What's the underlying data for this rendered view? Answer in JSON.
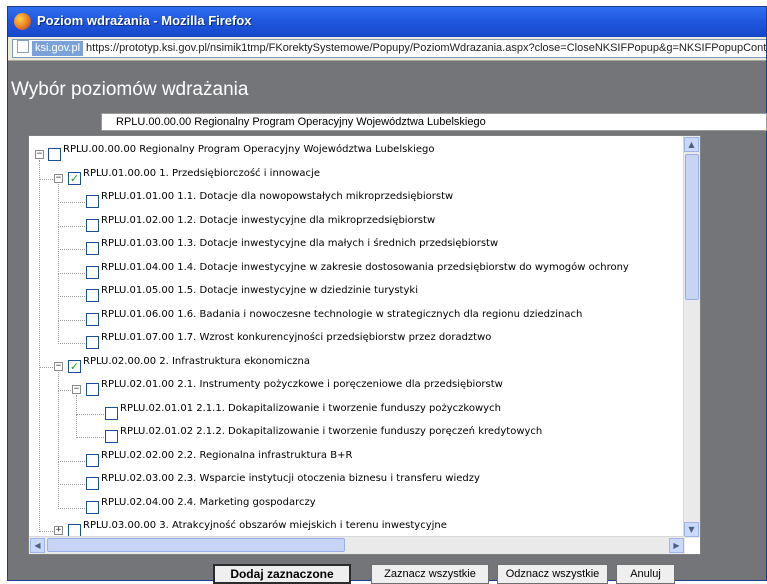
{
  "window": {
    "title": "Poziom wdrażania - Mozilla Firefox"
  },
  "addressbar": {
    "site_label": "ksi.gov.pl",
    "url": "https://prototyp.ksi.gov.pl/nsimik1tmp/FKorektySystemowe/Popupy/PoziomWdrazania.aspx?close=CloseNKSIFPopup&g=NKSIFPopupContentPlaceholder"
  },
  "dialog": {
    "heading": "Wybór poziomów wdrażania",
    "selected_value": "RPLU.00.00.00 Regionalny Program Operacyjny Województwa Lubelskiego"
  },
  "tree": {
    "nodes": [
      {
        "label": "RPLU.00.00.00 Regionalny Program Operacyjny Województwa Lubelskiego",
        "depth": 0,
        "toggle": "minus",
        "checked": false
      },
      {
        "label": "RPLU.01.00.00 1. Przedsiębiorczość i innowacje",
        "depth": 1,
        "toggle": "minus",
        "checked": true
      },
      {
        "label": "RPLU.01.01.00 1.1. Dotacje dla nowopowstałych mikroprzedsiębiorstw",
        "depth": 2,
        "toggle": "none",
        "checked": false
      },
      {
        "label": "RPLU.01.02.00 1.2. Dotacje inwestycyjne dla mikroprzedsiębiorstw",
        "depth": 2,
        "toggle": "none",
        "checked": false
      },
      {
        "label": "RPLU.01.03.00 1.3. Dotacje inwestycyjne dla małych i średnich przedsiębiorstw",
        "depth": 2,
        "toggle": "none",
        "checked": false
      },
      {
        "label": "RPLU.01.04.00 1.4. Dotacje inwestycyjne w zakresie dostosowania przedsiębiorstw do wymogów ochrony",
        "depth": 2,
        "toggle": "none",
        "checked": false
      },
      {
        "label": "RPLU.01.05.00 1.5. Dotacje inwestycyjne w dziedzinie turystyki",
        "depth": 2,
        "toggle": "none",
        "checked": false
      },
      {
        "label": "RPLU.01.06.00 1.6. Badania i nowoczesne technologie w strategicznych dla regionu dziedzinach",
        "depth": 2,
        "toggle": "none",
        "checked": false
      },
      {
        "label": "RPLU.01.07.00 1.7. Wzrost konkurencyjności przedsiębiorstw przez doradztwo",
        "depth": 2,
        "toggle": "none",
        "checked": false
      },
      {
        "label": "RPLU.02.00.00 2. Infrastruktura ekonomiczna",
        "depth": 1,
        "toggle": "minus",
        "checked": true
      },
      {
        "label": "RPLU.02.01.00 2.1. Instrumenty pożyczkowe i poręczeniowe dla przedsiębiorstw",
        "depth": 2,
        "toggle": "minus",
        "checked": false
      },
      {
        "label": "RPLU.02.01.01 2.1.1. Dokapitalizowanie i tworzenie funduszy pożyczkowych",
        "depth": 3,
        "toggle": "none",
        "checked": false
      },
      {
        "label": "RPLU.02.01.02 2.1.2. Dokapitalizowanie i tworzenie funduszy poręczeń kredytowych",
        "depth": 3,
        "toggle": "none",
        "checked": false
      },
      {
        "label": "RPLU.02.02.00 2.2. Regionalna infrastruktura B+R",
        "depth": 2,
        "toggle": "none",
        "checked": false
      },
      {
        "label": "RPLU.02.03.00 2.3. Wsparcie instytucji otoczenia biznesu i transferu wiedzy",
        "depth": 2,
        "toggle": "none",
        "checked": false
      },
      {
        "label": "RPLU.02.04.00 2.4. Marketing gospodarczy",
        "depth": 2,
        "toggle": "none",
        "checked": false
      },
      {
        "label": "RPLU.03.00.00 3. Atrakcyjność obszarów miejskich i terenu inwestycyjne",
        "depth": 1,
        "toggle": "plus",
        "checked": false
      }
    ]
  },
  "buttons": {
    "add_selected": "Dodaj zaznaczone",
    "select_all": "Zaznacz wszystkie",
    "deselect_all": "Odznacz wszystkie",
    "cancel": "Anuluj"
  },
  "icons": {
    "window": "firefox-icon",
    "site": "page-icon",
    "scroll_up": "up-arrow-icon",
    "scroll_down": "down-arrow-icon",
    "scroll_left": "left-arrow-icon",
    "scroll_right": "right-arrow-icon"
  },
  "colors": {
    "titlebar": "#1f58df",
    "dialog_bg": "#747579",
    "check": "#22a322"
  }
}
